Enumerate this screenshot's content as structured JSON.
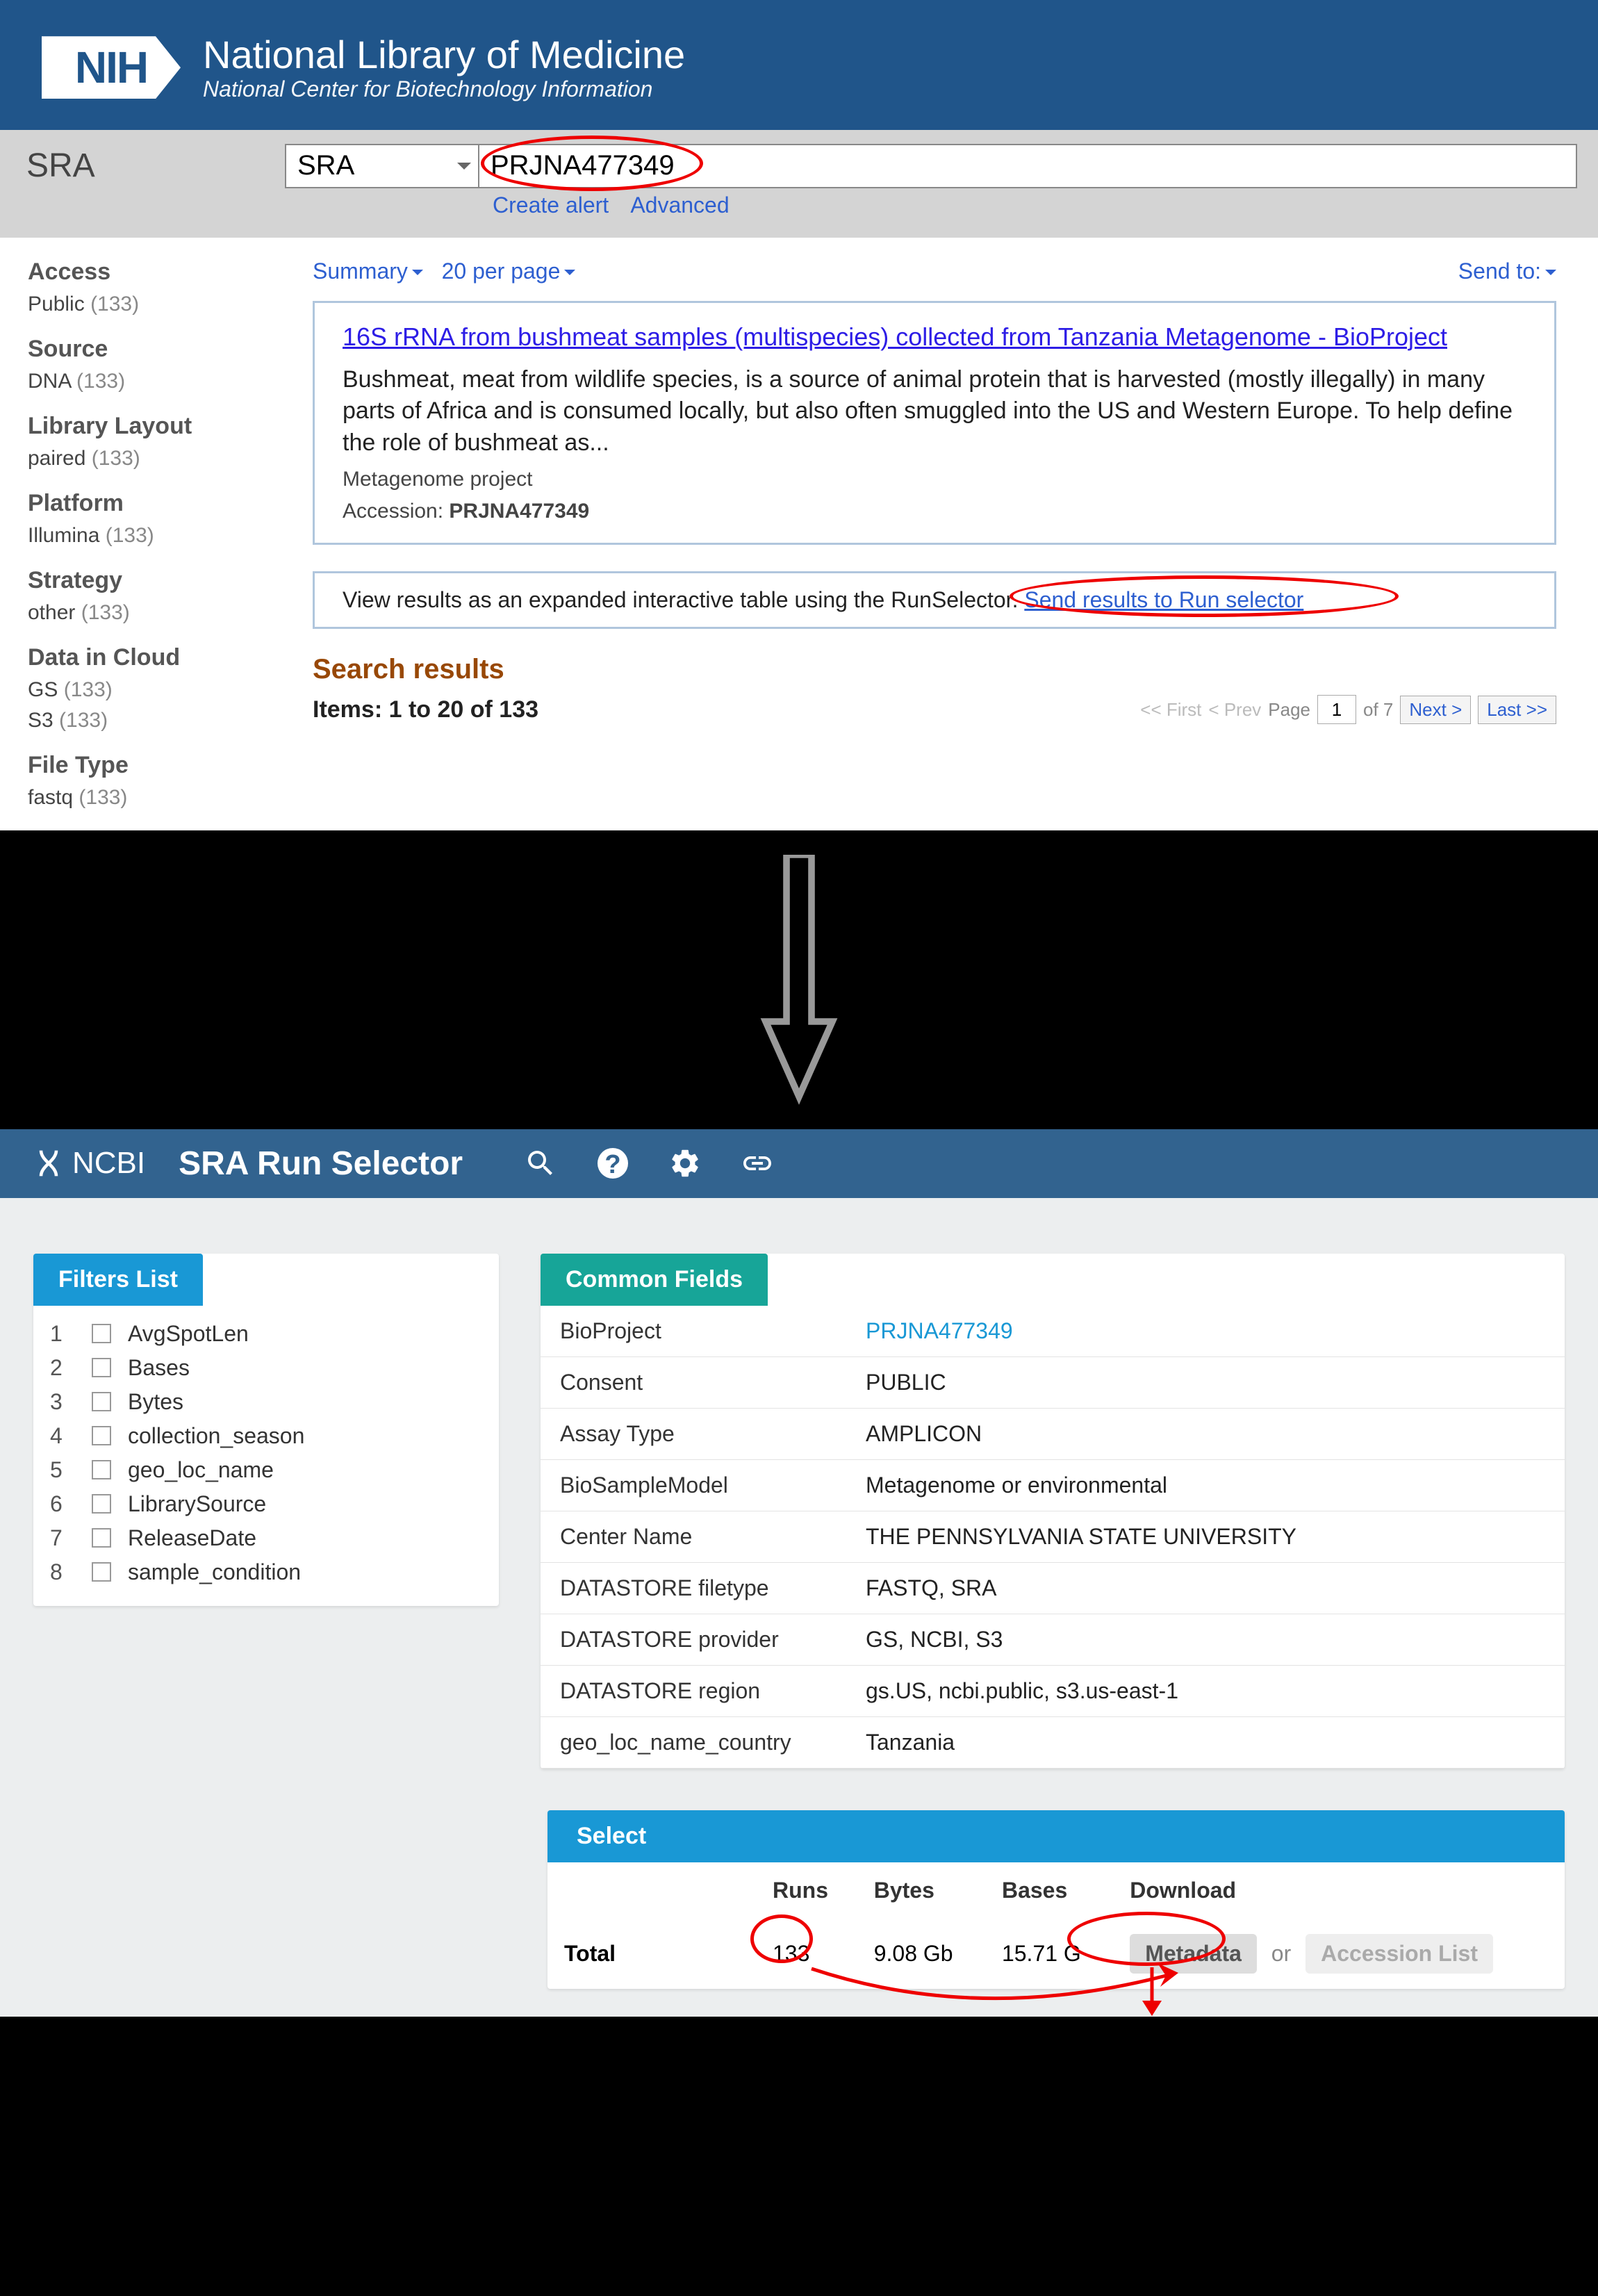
{
  "header": {
    "nih_badge": "NIH",
    "nlm_title": "National Library of Medicine",
    "nlm_subtitle": "National Center for Biotechnology Information"
  },
  "search": {
    "db_label": "SRA",
    "service_label": "SRA",
    "query": "PRJNA477349",
    "create_alert": "Create alert",
    "advanced": "Advanced"
  },
  "facets": [
    {
      "head": "Access",
      "items": [
        {
          "label": "Public",
          "count": "(133)"
        }
      ]
    },
    {
      "head": "Source",
      "items": [
        {
          "label": "DNA",
          "count": "(133)"
        }
      ]
    },
    {
      "head": "Library Layout",
      "items": [
        {
          "label": "paired",
          "count": "(133)"
        }
      ]
    },
    {
      "head": "Platform",
      "items": [
        {
          "label": "Illumina",
          "count": "(133)"
        }
      ]
    },
    {
      "head": "Strategy",
      "items": [
        {
          "label": "other",
          "count": "(133)"
        }
      ]
    },
    {
      "head": "Data in Cloud",
      "items": [
        {
          "label": "GS",
          "count": "(133)"
        },
        {
          "label": "S3",
          "count": "(133)"
        }
      ]
    },
    {
      "head": "File Type",
      "items": [
        {
          "label": "fastq",
          "count": "(133)"
        }
      ]
    }
  ],
  "top_controls": {
    "summary": "Summary",
    "per_page": "20 per page",
    "send_to": "Send to:"
  },
  "result": {
    "title": "16S rRNA from bushmeat samples (multispecies) collected from Tanzania Metagenome - BioProject",
    "desc": "Bushmeat, meat from wildlife species, is a source of animal protein that is harvested (mostly illegally) in many parts of Africa and is consumed locally, but also often smuggled into the US and Western Europe. To help define the role of bushmeat as...",
    "meta1": "Metagenome project",
    "accession_label": "Accession: ",
    "accession": "PRJNA477349"
  },
  "runselector_bar": {
    "text": "View results as an expanded interactive table using the RunSelector. ",
    "link": "Send results to Run selector"
  },
  "search_results": {
    "heading": "Search results",
    "items_line": "Items: 1 to 20 of 133",
    "first": "<< First",
    "prev": "< Prev",
    "page_label": "Page",
    "page_value": "1",
    "of_label": "of 7",
    "next": "Next >",
    "last": "Last >>"
  },
  "rs_header": {
    "ncbi": "NCBI",
    "title": "SRA Run Selector"
  },
  "filters": {
    "tab": "Filters List",
    "items": [
      "AvgSpotLen",
      "Bases",
      "Bytes",
      "collection_season",
      "geo_loc_name",
      "LibrarySource",
      "ReleaseDate",
      "sample_condition"
    ]
  },
  "common_fields": {
    "tab": "Common Fields",
    "rows": [
      [
        "BioProject",
        "PRJNA477349"
      ],
      [
        "Consent",
        "PUBLIC"
      ],
      [
        "Assay Type",
        "AMPLICON"
      ],
      [
        "BioSampleModel",
        "Metagenome or environmental"
      ],
      [
        "Center Name",
        "THE PENNSYLVANIA STATE UNIVERSITY"
      ],
      [
        "DATASTORE filetype",
        "FASTQ, SRA"
      ],
      [
        "DATASTORE provider",
        "GS, NCBI, S3"
      ],
      [
        "DATASTORE region",
        "gs.US, ncbi.public, s3.us-east-1"
      ],
      [
        "geo_loc_name_country",
        "Tanzania"
      ]
    ]
  },
  "select": {
    "tab": "Select",
    "head": [
      "",
      "Runs",
      "Bytes",
      "Bases",
      "Download"
    ],
    "total_label": "Total",
    "runs": "133",
    "bytes": "9.08 Gb",
    "bases": "15.71 G",
    "metadata_btn": "Metadata",
    "or": "or",
    "accession_btn": "Accession List"
  }
}
